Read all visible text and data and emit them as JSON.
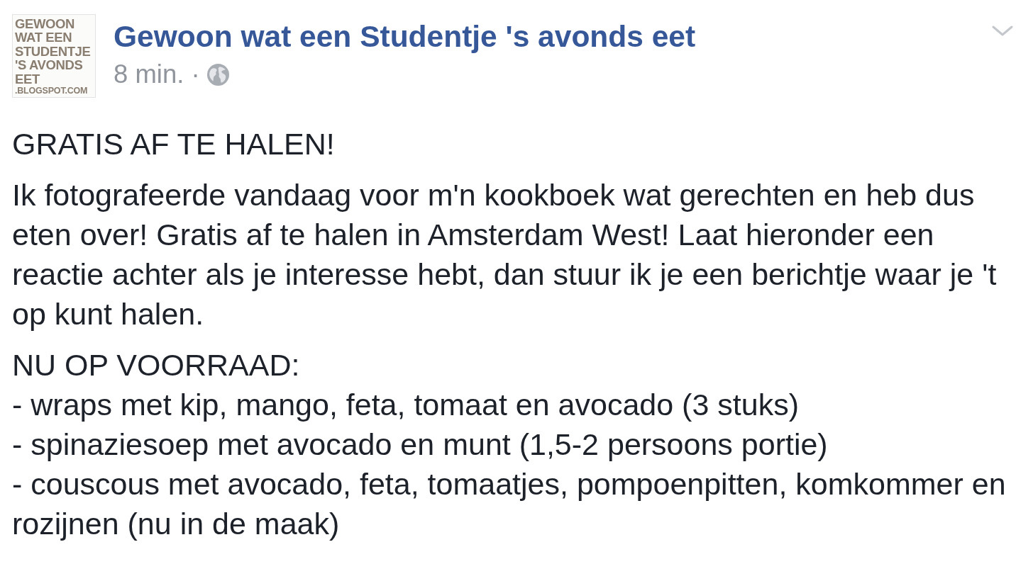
{
  "post": {
    "avatar": {
      "lines": [
        "GEWOON",
        "WAT EEN",
        "STUDENTJE",
        "'S AVONDS",
        "EET",
        ".BLOGSPOT.COM"
      ]
    },
    "author": "Gewoon wat een Studentje 's avonds eet",
    "time": "8 min.",
    "separator": "·",
    "paragraphs": [
      {
        "lines": [
          "GRATIS AF TE HALEN!"
        ]
      },
      {
        "lines": [
          "Ik fotografeerde vandaag voor m'n kookboek wat gerechten en heb dus eten over! Gratis af te halen in Amsterdam West! Laat hieronder een reactie achter als je interesse hebt, dan stuur ik je een berichtje waar je 't op kunt halen."
        ]
      },
      {
        "lines": [
          "NU OP VOORRAAD:",
          "- wraps met kip, mango, feta, tomaat en avocado (3 stuks)",
          "- spinaziesoep met avocado en munt (1,5-2 persoons portie)",
          "- couscous met avocado, feta, tomaatjes, pompoenpitten, komkommer en rozijnen (nu in de maak)"
        ]
      }
    ]
  }
}
